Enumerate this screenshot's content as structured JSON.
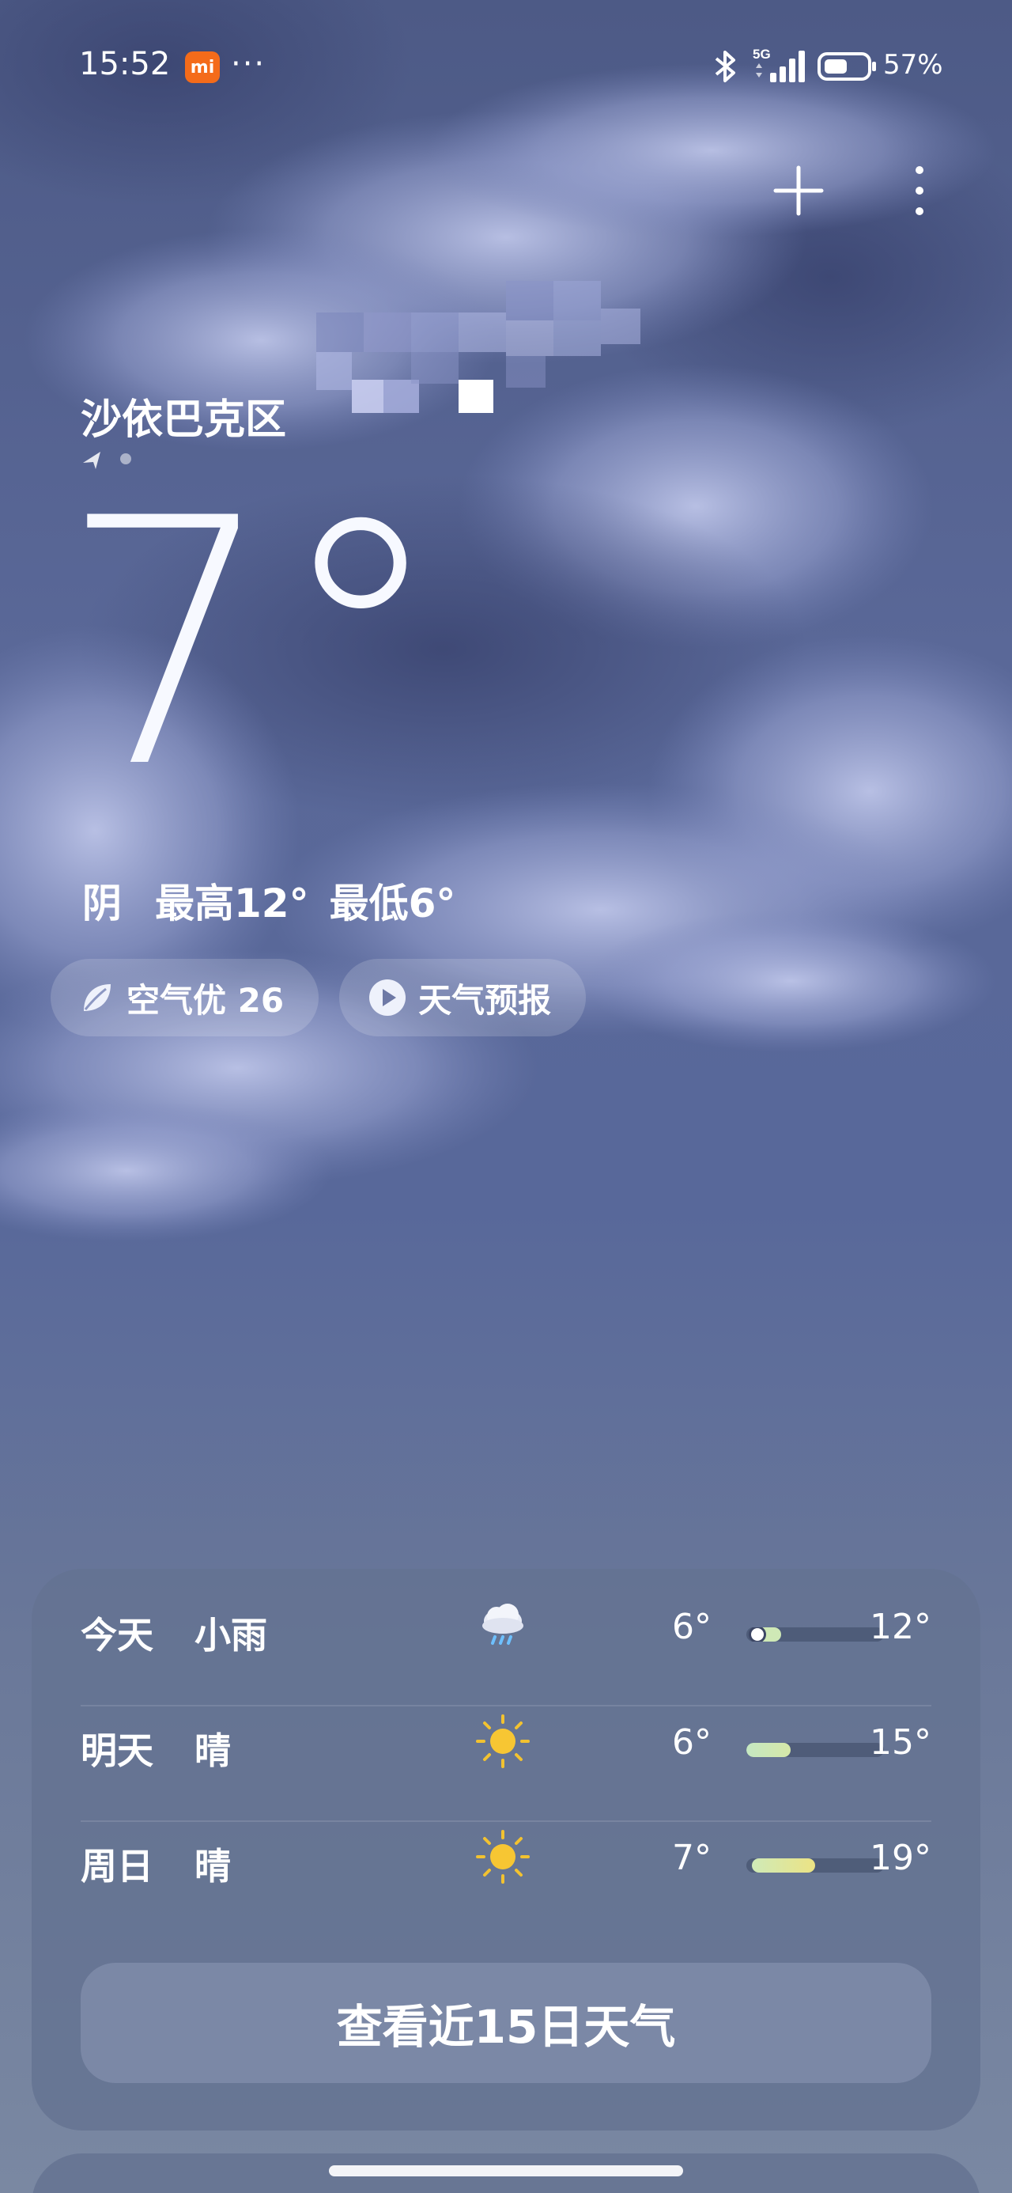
{
  "status_bar": {
    "time": "15:52",
    "mi_badge": "mi",
    "more_dots": "···",
    "network": "5G",
    "battery": "57%"
  },
  "location": {
    "district": "沙依巴克区"
  },
  "current": {
    "temperature": "7°",
    "condition": "阴",
    "high": "最高12°",
    "low": "最低6°"
  },
  "chips": {
    "air_quality": "空气优 26",
    "forecast_video": "天气预报"
  },
  "forecast": {
    "rows": [
      {
        "day": "今天",
        "condition": "小雨",
        "icon": "light-rain-icon",
        "low": "6°",
        "high": "12°",
        "range_start": 0.05,
        "range_end": 0.2,
        "current_marker": true
      },
      {
        "day": "明天",
        "condition": "晴",
        "icon": "sunny-icon",
        "low": "6°",
        "high": "15°",
        "range_start": 0.0,
        "range_end": 0.32,
        "current_marker": false
      },
      {
        "day": "周日",
        "condition": "晴",
        "icon": "sunny-icon",
        "low": "7°",
        "high": "19°",
        "range_start": 0.04,
        "range_end": 0.46,
        "current_marker": false
      }
    ],
    "cta_label": "查看近15日天气"
  },
  "colors": {
    "sky_top": "#5b6a99",
    "card_bg": "#64739a",
    "bar_cool": "#cfe9b6",
    "bar_warm": "#e7e08a",
    "mi_orange": "#f46b1a"
  }
}
